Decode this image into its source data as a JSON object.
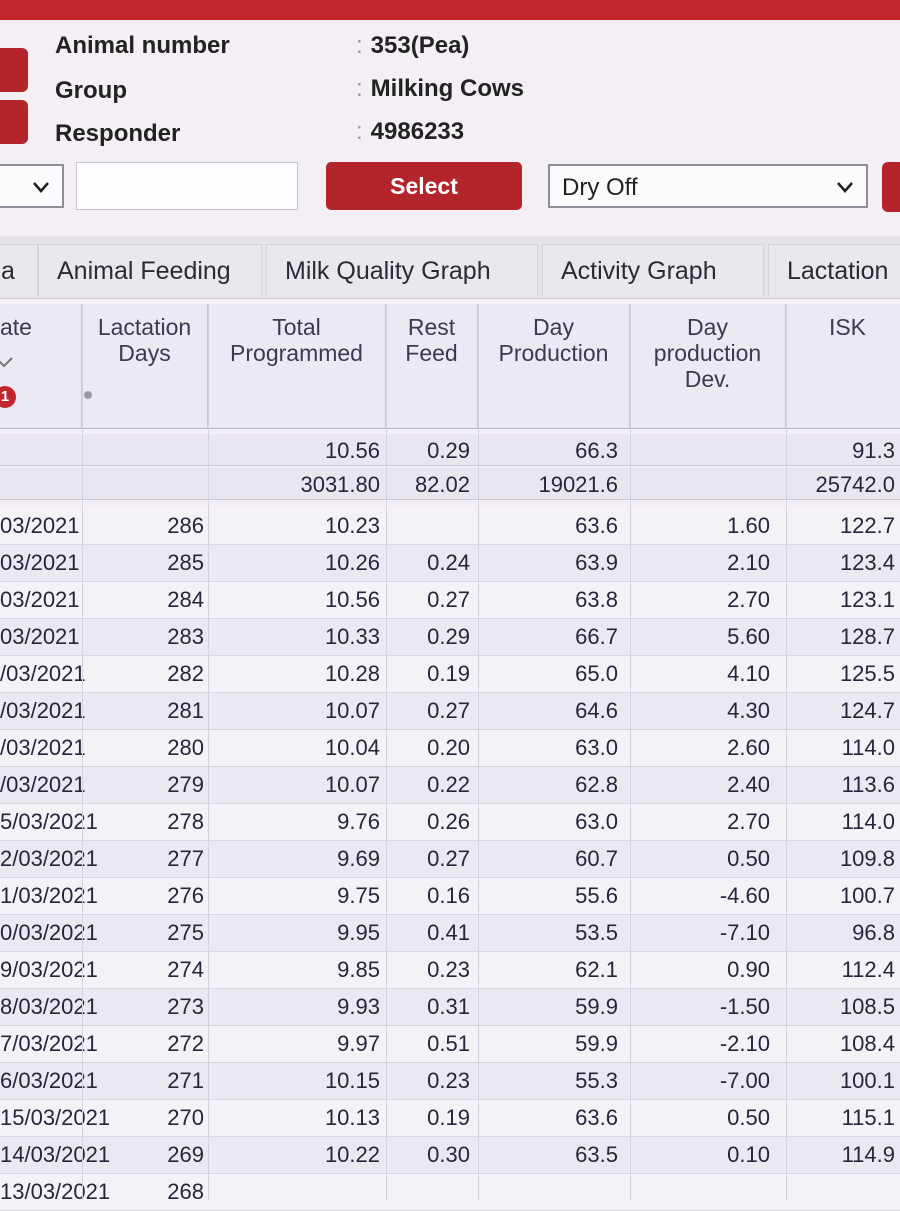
{
  "info": {
    "animal_number_label": "Animal number",
    "animal_number_value": "353(Pea)",
    "group_label": "Group",
    "group_value": "Milking Cows",
    "responder_label": "Responder",
    "responder_value": "4986233",
    "colon": ":"
  },
  "controls": {
    "select_label": "Select",
    "action_value": "Dry Off"
  },
  "tabs": [
    "a",
    "Animal Feeding",
    "Milk Quality Graph",
    "Activity Graph",
    "Lactation"
  ],
  "columns": [
    "ate",
    "Lactation\nDays",
    "Total\nProgrammed",
    "Rest\nFeed",
    "Day\nProduction",
    "Day\nproduction\nDev.",
    "ISK"
  ],
  "summary": [
    [
      "",
      "",
      "10.56",
      "0.29",
      "66.3",
      "",
      "91.3"
    ],
    [
      "",
      "",
      "3031.80",
      "82.02",
      "19021.6",
      "",
      "25742.0"
    ]
  ],
  "rows": [
    [
      "03/2021",
      "286",
      "10.23",
      "",
      "63.6",
      "1.60",
      "122.7"
    ],
    [
      "03/2021",
      "285",
      "10.26",
      "0.24",
      "63.9",
      "2.10",
      "123.4"
    ],
    [
      "03/2021",
      "284",
      "10.56",
      "0.27",
      "63.8",
      "2.70",
      "123.1"
    ],
    [
      "03/2021",
      "283",
      "10.33",
      "0.29",
      "66.7",
      "5.60",
      "128.7"
    ],
    [
      "/03/2021",
      "282",
      "10.28",
      "0.19",
      "65.0",
      "4.10",
      "125.5"
    ],
    [
      "/03/2021",
      "281",
      "10.07",
      "0.27",
      "64.6",
      "4.30",
      "124.7"
    ],
    [
      "/03/2021",
      "280",
      "10.04",
      "0.20",
      "63.0",
      "2.60",
      "114.0"
    ],
    [
      "/03/2021",
      "279",
      "10.07",
      "0.22",
      "62.8",
      "2.40",
      "113.6"
    ],
    [
      "5/03/2021",
      "278",
      "9.76",
      "0.26",
      "63.0",
      "2.70",
      "114.0"
    ],
    [
      "2/03/2021",
      "277",
      "9.69",
      "0.27",
      "60.7",
      "0.50",
      "109.8"
    ],
    [
      "1/03/2021",
      "276",
      "9.75",
      "0.16",
      "55.6",
      "-4.60",
      "100.7"
    ],
    [
      "0/03/2021",
      "275",
      "9.95",
      "0.41",
      "53.5",
      "-7.10",
      "96.8"
    ],
    [
      "9/03/2021",
      "274",
      "9.85",
      "0.23",
      "62.1",
      "0.90",
      "112.4"
    ],
    [
      "8/03/2021",
      "273",
      "9.93",
      "0.31",
      "59.9",
      "-1.50",
      "108.5"
    ],
    [
      "7/03/2021",
      "272",
      "9.97",
      "0.51",
      "59.9",
      "-2.10",
      "108.4"
    ],
    [
      "6/03/2021",
      "271",
      "10.15",
      "0.23",
      "55.3",
      "-7.00",
      "100.1"
    ],
    [
      "15/03/2021",
      "270",
      "10.13",
      "0.19",
      "63.6",
      "0.50",
      "115.1"
    ],
    [
      "14/03/2021",
      "269",
      "10.22",
      "0.30",
      "63.5",
      "0.10",
      "114.9"
    ],
    [
      "13/03/2021",
      "268",
      "",
      "",
      "",
      "",
      ""
    ]
  ],
  "colors": {
    "accent": "#b3252a"
  }
}
